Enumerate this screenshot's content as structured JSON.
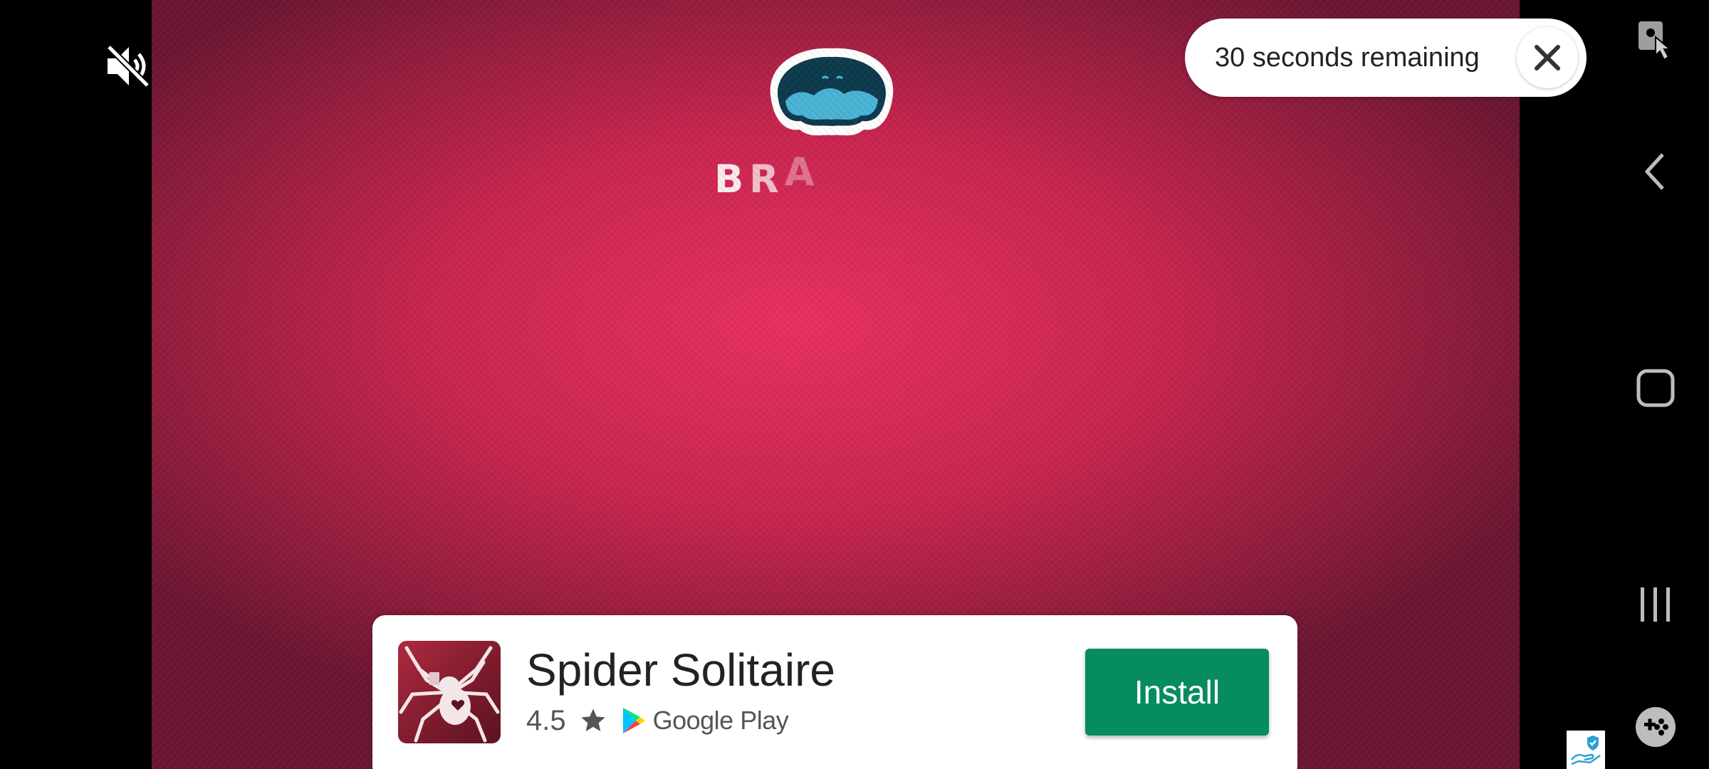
{
  "ad": {
    "brand_text_letters": [
      "B",
      "R",
      "A"
    ],
    "timer": {
      "text": "30 seconds remaining"
    },
    "install_card": {
      "app_name": "Spider Solitaire",
      "rating": "4.5",
      "store_name": "Google Play",
      "install_label": "Install",
      "install_color": "#078b60"
    },
    "background_color": "#d62a55"
  },
  "controls": {
    "mute_icon": "volume-off-icon",
    "close_icon": "close-icon"
  },
  "nav_bar": {
    "items": [
      {
        "name": "screen-lock-touch-icon"
      },
      {
        "name": "back-icon"
      },
      {
        "name": "home-icon"
      },
      {
        "name": "recents-icon"
      },
      {
        "name": "game-tools-icon"
      }
    ]
  }
}
